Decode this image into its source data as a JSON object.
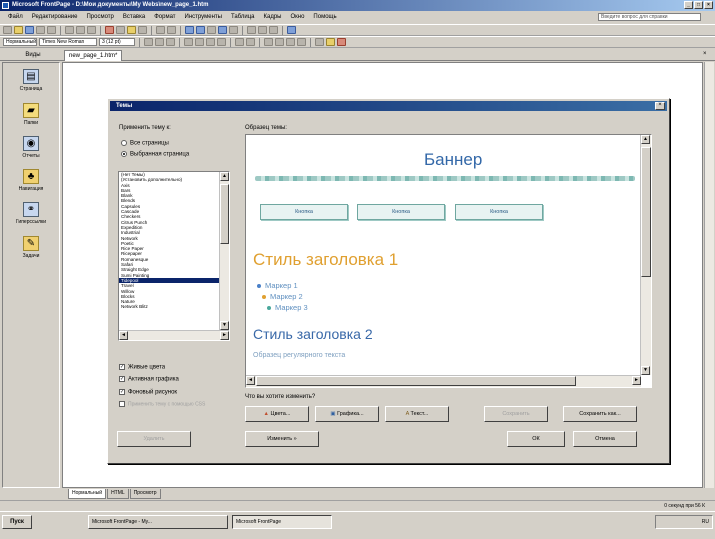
{
  "window": {
    "title": "Microsoft FrontPage - D:\\Мои документы\\My Webs\\new_page_1.htm",
    "min": "_",
    "max": "□",
    "close": "×"
  },
  "menu": [
    "Файл",
    "Редактирование",
    "Просмотр",
    "Вставка",
    "Формат",
    "Инструменты",
    "Таблица",
    "Кадры",
    "Окно",
    "Помощь"
  ],
  "help_placeholder": "Введите вопрос для справки",
  "toolbar2": {
    "style_value": "Нормальный",
    "font_value": "Times New Roman",
    "size_value": "3 (12 pt)"
  },
  "views": {
    "header": "Виды",
    "items": [
      {
        "label": "Страница",
        "icon": "page-icon",
        "glyph": "▤"
      },
      {
        "label": "Папки",
        "icon": "folders-icon",
        "glyph": "▰"
      },
      {
        "label": "Отчеты",
        "icon": "reports-icon",
        "glyph": "◉"
      },
      {
        "label": "Навигация",
        "icon": "navigation-icon",
        "glyph": "♣"
      },
      {
        "label": "Гиперссылки",
        "icon": "hyperlinks-icon",
        "glyph": "⚭"
      },
      {
        "label": "Задачи",
        "icon": "tasks-icon",
        "glyph": "✎"
      }
    ]
  },
  "doc_tab": "new_page_1.htm*",
  "bottom_tabs": [
    "Нормальный",
    "HTML",
    "Просмотр"
  ],
  "status_right": "0 секунд при 56 К",
  "taskbar": {
    "start": "Пуск",
    "items": [
      "Microsoft FrontPage - My...",
      "Microsoft FrontPage"
    ],
    "tray": "RU"
  },
  "dialog": {
    "title": "Темы",
    "close": "×",
    "apply_label": "Применить тему к:",
    "radio_all": "Все страницы",
    "radio_selected": "Выбранная страница",
    "themes": [
      "(Нет Темы)",
      "(Установить дополнительно)",
      "Axis",
      "Bars",
      "Blank",
      "Blends",
      "Capsules",
      "Cascade",
      "Checkers",
      "Citrus Punch",
      "Expedition",
      "Industrial",
      "Network",
      "Poetic",
      "Rice Paper",
      "Ricepaper",
      "Romanesque",
      "Safari",
      "Straight Edge",
      "Sumi Painting",
      "Tidepool",
      "Travel",
      "Willow",
      "Blocks",
      "Nature",
      "Network Blitz"
    ],
    "themes_selected_index": 20,
    "check_vivid": "Живые цвета",
    "check_graphics": "Активная графика",
    "check_bg": "Фоновый рисунок",
    "check_css": "Применить тему с помощью CSS",
    "delete_btn": "Удалить",
    "preview_label": "Образец темы:",
    "modify_label": "Что вы хотите изменить?",
    "btn_colors": "Цвета...",
    "btn_graphics": "Графика...",
    "btn_text": "Текст...",
    "btn_save": "Сохранить",
    "btn_saveas": "Сохранить как...",
    "modify_btn": "Изменить »",
    "ok": "ОК",
    "cancel": "Отмена",
    "preview": {
      "banner": "Баннер",
      "button": "Кнопка",
      "heading1": "Стиль заголовка 1",
      "bullets": [
        "Маркер 1",
        "Маркер 2",
        "Маркер 3"
      ],
      "heading2": "Стиль заголовка 2",
      "body": "Образец регулярного текста"
    }
  },
  "colors": {
    "title_start": "#0a246a",
    "banner": "#3368a8",
    "heading1": "#e0a030",
    "bullet1": "#4a80c8",
    "bullet2": "#e0a030",
    "bullet3": "#4aa89c"
  }
}
